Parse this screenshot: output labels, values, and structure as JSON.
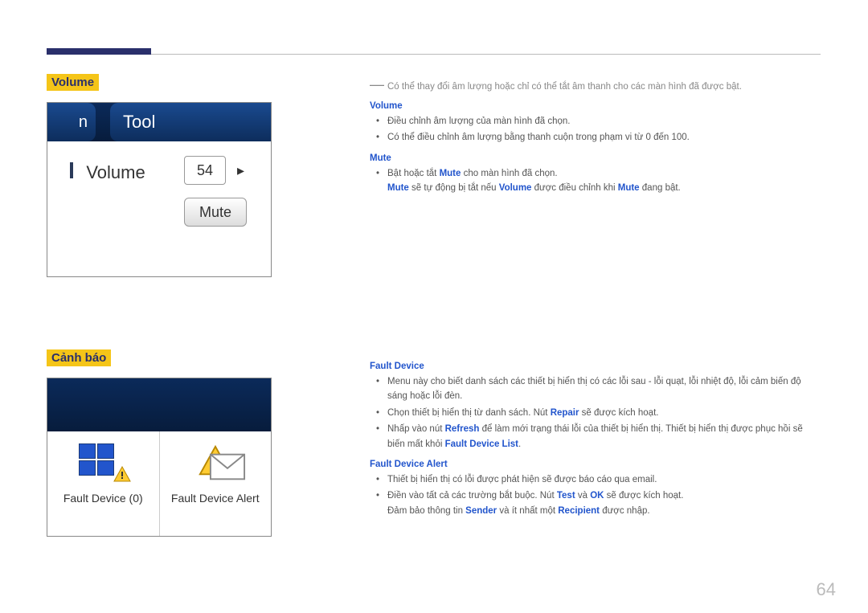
{
  "section1": {
    "title": "Volume",
    "intro": "Có thể thay đổi âm lượng hoặc chỉ có thể tắt âm thanh cho các màn hình đã được bật.",
    "volume_head": "Volume",
    "vol_b1": "Điều chỉnh âm lượng của màn hình đã chọn.",
    "vol_b2": "Có thể điều chỉnh âm lượng bằng thanh cuộn trong phạm vi từ 0 đến 100.",
    "mute_head": "Mute",
    "mute_b1_pre": "Bật hoặc tắt ",
    "mute_b1_kw": "Mute",
    "mute_b1_post": " cho màn hình đã chọn.",
    "mute_note_1": "Mute",
    "mute_note_2": " sẽ tự động bị tắt nếu ",
    "mute_note_3": "Volume",
    "mute_note_4": " được điều chỉnh khi ",
    "mute_note_5": "Mute",
    "mute_note_6": " đang bật."
  },
  "img1": {
    "tab_left": "n",
    "tab_tool": "Tool",
    "vol_label": "Volume",
    "vol_value": "54",
    "mute_btn": "Mute"
  },
  "section2": {
    "title": "Cảnh báo",
    "fd_head": "Fault Device",
    "fd_b1": "Menu này cho biết danh sách các thiết bị hiển thị có các lỗi sau - lỗi quạt, lỗi nhiệt độ, lỗi cảm biến độ sáng hoặc lỗi đèn.",
    "fd_b2_pre": "Chọn thiết bị hiển thị từ danh sách. Nút ",
    "fd_b2_kw": "Repair",
    "fd_b2_post": " sẽ được kích hoạt.",
    "fd_b3_pre": "Nhấp vào nút ",
    "fd_b3_kw": "Refresh",
    "fd_b3_mid": " để làm mới trạng thái lỗi của thiết bị hiển thị. Thiết bị hiển thị được phục hồi sẽ biến mất khỏi ",
    "fd_b3_kw2": "Fault Device List",
    "fd_b3_post": ".",
    "fda_head": "Fault Device Alert",
    "fda_b1": "Thiết bị hiển thị có lỗi được phát hiện sẽ được báo cáo qua email.",
    "fda_b2_pre": "Điền vào tất cả các trường bắt buộc. Nút ",
    "fda_b2_kw1": "Test",
    "fda_b2_mid": " và ",
    "fda_b2_kw2": "OK",
    "fda_b2_post": " sẽ được kích hoạt.",
    "fda_note_pre": "Đảm bảo thông tin ",
    "fda_note_kw1": "Sender",
    "fda_note_mid": " và ít nhất một ",
    "fda_note_kw2": "Recipient",
    "fda_note_post": " được nhập."
  },
  "img2": {
    "cell1": "Fault Device (0)",
    "cell2": "Fault Device Alert"
  },
  "page_number": "64"
}
